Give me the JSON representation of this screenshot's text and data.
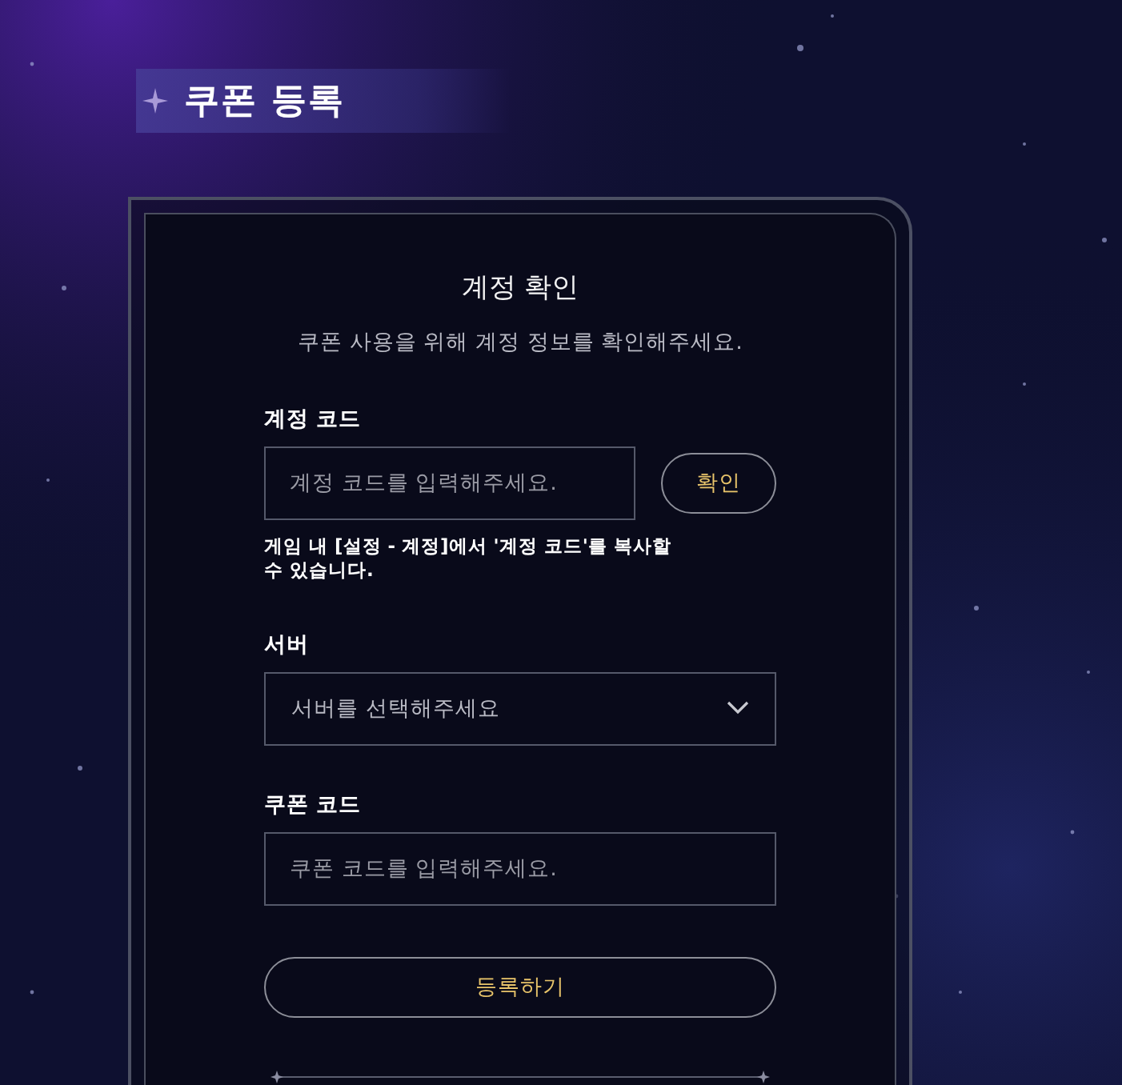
{
  "header": {
    "title": "쿠폰 등록"
  },
  "card": {
    "title": "계정 확인",
    "subtitle": "쿠폰 사용을 위해 계정 정보를 확인해주세요.",
    "account": {
      "label": "계정 코드",
      "placeholder": "계정 코드를 입력해주세요.",
      "button": "확인",
      "help": "게임 내 [설정 - 계정]에서 '계정 코드'를 복사할 수 있습니다."
    },
    "server": {
      "label": "서버",
      "placeholder": "서버를 선택해주세요"
    },
    "coupon": {
      "label": "쿠폰 코드",
      "placeholder": "쿠폰 코드를 입력해주세요."
    },
    "submit": "등록하기"
  }
}
